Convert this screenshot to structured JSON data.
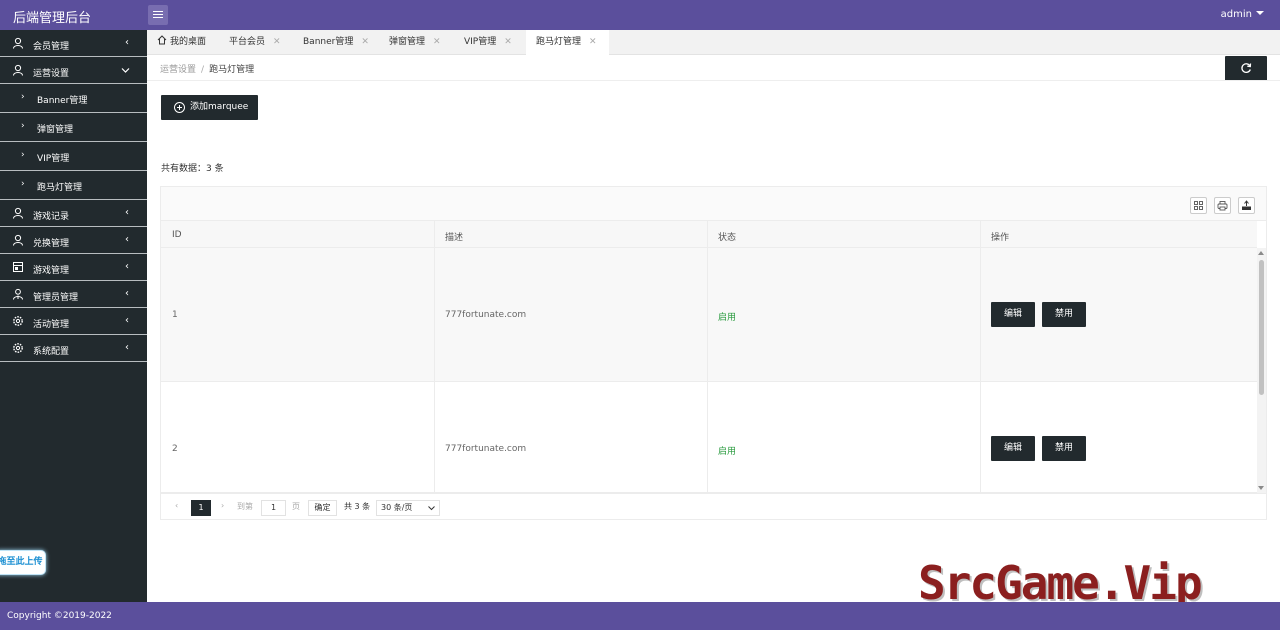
{
  "header": {
    "app_title": "后端管理后台",
    "user": "admin"
  },
  "sidebar": {
    "items": [
      {
        "label": "会员管理",
        "icon": "user-icon"
      },
      {
        "label": "运营设置",
        "icon": "user-icon"
      },
      {
        "label": "游戏记录",
        "icon": "user-icon"
      },
      {
        "label": "兑换管理",
        "icon": "user-icon"
      },
      {
        "label": "游戏管理",
        "icon": "calendar-icon"
      },
      {
        "label": "管理员管理",
        "icon": "admin-icon"
      },
      {
        "label": "活动管理",
        "icon": "gear-icon"
      },
      {
        "label": "系统配置",
        "icon": "gear-icon"
      }
    ],
    "sub_items": [
      "Banner管理",
      "弹窗管理",
      "VIP管理",
      "跑马灯管理"
    ],
    "upload_label": "拖至此上传"
  },
  "tabs": [
    "我的桌面",
    "平台会员",
    "Banner管理",
    "弹窗管理",
    "VIP管理",
    "跑马灯管理"
  ],
  "breadcrumb": {
    "parent": "运营设置",
    "current": "跑马灯管理"
  },
  "main": {
    "add_button": "添加marquee",
    "count_text": "共有数据：3 条"
  },
  "table": {
    "columns": [
      "ID",
      "描述",
      "状态",
      "操作"
    ],
    "rows": [
      {
        "id": "1",
        "desc": "777fortunate.com",
        "status": "启用",
        "edit": "编辑",
        "disable": "禁用"
      },
      {
        "id": "2",
        "desc": "777fortunate.com",
        "status": "启用",
        "edit": "编辑",
        "disable": "禁用"
      }
    ]
  },
  "pager": {
    "current_page": "1",
    "goto_label": "到第",
    "page_input": "1",
    "page_unit": "页",
    "confirm": "确定",
    "total": "共 3 条",
    "page_size": "30 条/页"
  },
  "watermark": "SrcGame.Vip",
  "footer": {
    "copyright": "Copyright ©2019-2022"
  },
  "colors": {
    "brand": "#5b4f9c",
    "sidebar": "#222a2e",
    "status_ok": "#2a9b3f"
  }
}
